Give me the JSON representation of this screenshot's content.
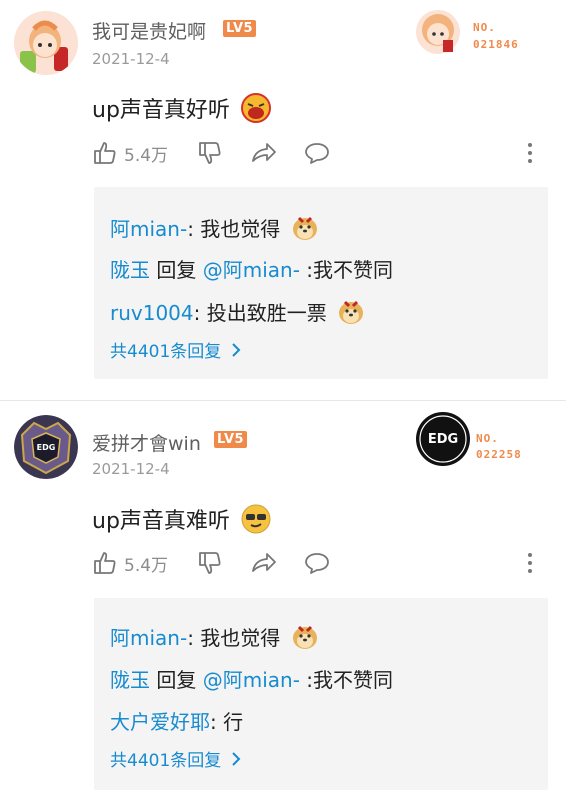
{
  "comments": [
    {
      "username": "我可是贵妃啊",
      "level": "LV5",
      "date": "2021-12-4",
      "text": "up声音真好听",
      "emoji_icon": "laughing-face-icon",
      "likes": "5.4万",
      "badge": {
        "label": "NO.",
        "number": "021846"
      },
      "replies": [
        {
          "user": "阿mian-",
          "sep": ": ",
          "content": "我也觉得",
          "emoji_icon": "doge-icon"
        },
        {
          "user": "陇玉",
          "sep": " 回复 ",
          "mention": "@阿mian-",
          "content": " :我不赞同"
        },
        {
          "user": "ruv1004",
          "sep": ": ",
          "content": "投出致胜一票",
          "emoji_icon": "doge-icon"
        }
      ],
      "more_replies": "共4401条回复"
    },
    {
      "username": "爱拼才會win",
      "level": "LV5",
      "date": "2021-12-4",
      "text": "up声音真难听",
      "emoji_icon": "sunglasses-face-icon",
      "likes": "5.4万",
      "badge": {
        "label": "NO.",
        "number": "022258",
        "logo": "EDG"
      },
      "replies": [
        {
          "user": "阿mian-",
          "sep": ": ",
          "content": "我也觉得",
          "emoji_icon": "doge-icon"
        },
        {
          "user": "陇玉",
          "sep": " 回复 ",
          "mention": "@阿mian-",
          "content": " :我不赞同"
        },
        {
          "user": "大户爱好耶",
          "sep": ": ",
          "content": "行"
        }
      ],
      "more_replies": "共4401条回复"
    }
  ],
  "colors": {
    "link": "#178bcf",
    "level": "#f08a4b",
    "reply_bg": "#f4f4f4"
  }
}
